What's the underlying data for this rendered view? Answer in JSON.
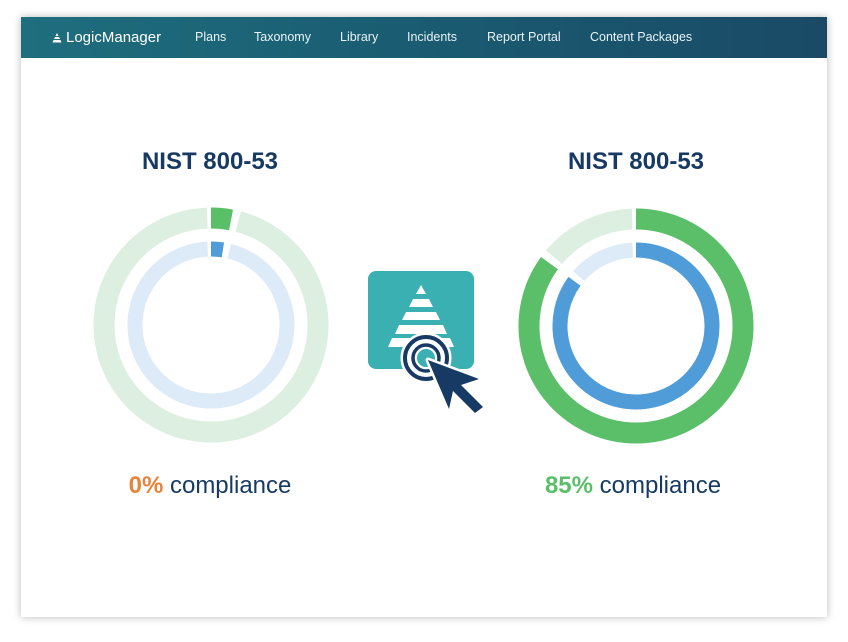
{
  "navbar": {
    "brand": "LogicManager",
    "items": [
      "Plans",
      "Taxonomy",
      "Library",
      "Incidents",
      "Report Portal",
      "Content Packages"
    ]
  },
  "left_panel": {
    "title": "NIST 800-53",
    "percent_text": "0%",
    "label": "compliance",
    "percent_color": "#e8843a",
    "outer_progress": 0.03,
    "inner_progress": 0.025
  },
  "right_panel": {
    "title": "NIST 800-53",
    "percent_text": "85%",
    "label": "compliance",
    "percent_color": "#5bbf6a",
    "outer_progress": 0.85,
    "inner_progress": 0.85
  },
  "colors": {
    "outer_track": "#dcefe0",
    "outer_fill": "#5bbf6a",
    "inner_track": "#ddeaf7",
    "inner_fill": "#4f9cd9",
    "title": "#173a64",
    "app_icon": "#3bb0b3",
    "cursor": "#173a64"
  },
  "icons": {
    "center": "logicmanager-pyramid-icon",
    "cursor": "click-cursor-icon"
  }
}
